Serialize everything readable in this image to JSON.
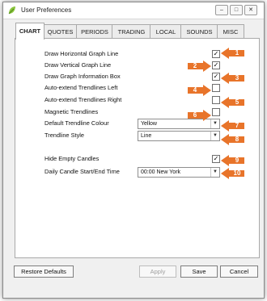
{
  "window": {
    "title": "User Preferences",
    "controls": {
      "minimize": "–",
      "maximize": "□",
      "close": "✕"
    }
  },
  "tabs": [
    "CHART",
    "QUOTES",
    "PERIODS",
    "TRADING",
    "LOCAL",
    "SOUNDS",
    "MISC"
  ],
  "active_tab": "CHART",
  "settings": {
    "draw_horizontal": {
      "label": "Draw Horizontal Graph Line",
      "checked": "✓"
    },
    "draw_vertical": {
      "label": "Draw Vertical Graph Line",
      "checked": "✓"
    },
    "draw_info_box": {
      "label": "Draw Graph Information Box",
      "checked": "✓"
    },
    "auto_left": {
      "label": "Auto-extend Trendlines Left",
      "checked": ""
    },
    "auto_right": {
      "label": "Auto-extend Trendlines Right",
      "checked": ""
    },
    "magnetic": {
      "label": "Magnetic Trendlines",
      "checked": ""
    },
    "trend_colour": {
      "label": "Default Trendline Colour",
      "value": "Yellow"
    },
    "trend_style": {
      "label": "Trendline Style",
      "value": "Line"
    },
    "hide_empty": {
      "label": "Hide Empty Candles",
      "checked": "✓"
    },
    "daily_candle": {
      "label": "Daily Candle Start/End Time",
      "value": "00:00 New York"
    }
  },
  "callouts": [
    "1",
    "2",
    "3",
    "4",
    "5",
    "6",
    "7",
    "8",
    "9",
    "10"
  ],
  "buttons": {
    "restore": "Restore Defaults",
    "apply": "Apply",
    "save": "Save",
    "cancel": "Cancel"
  },
  "colors": {
    "callout": "#e8742a",
    "icon_green": "#8cc63f"
  },
  "icons": {
    "app": "leaf-icon",
    "dropdown": "chevron-down-icon",
    "callout": "arrow-left-icon"
  }
}
